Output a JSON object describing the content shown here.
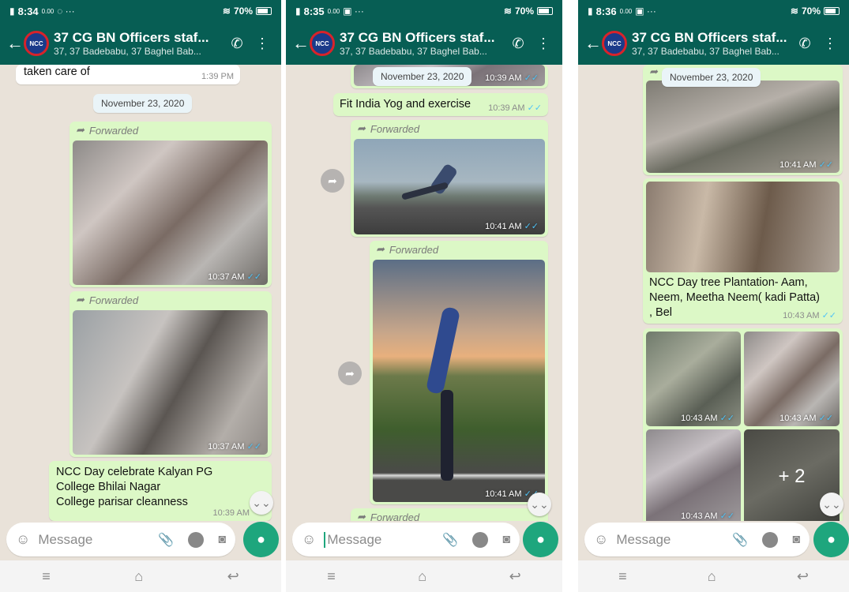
{
  "colors": {
    "header": "#075e54",
    "outgoing": "#dcf8c6",
    "mic": "#1ea67d",
    "ticks": "#4fc3f7"
  },
  "panels": [
    {
      "status": {
        "time": "8:34",
        "net": "0.00",
        "battery": "70%"
      },
      "header": {
        "title": "37 CG BN Officers staf...",
        "subtitle": "37, 37 Badebabu, 37 Baghel Bab..."
      },
      "msgs": {
        "m0_text": "taken care of",
        "m0_time": "1:39 PM",
        "date": "November 23, 2020",
        "m1_fwd": "Forwarded",
        "m1_time": "10:37 AM",
        "m2_fwd": "Forwarded",
        "m2_time": "10:37 AM",
        "m3_text": [
          "NCC Day celebrate Kalyan PG",
          "College Bhilai Nagar",
          "College parisar cleanness"
        ],
        "m3_time": "10:39 AM"
      },
      "input": {
        "placeholder": "Message"
      }
    },
    {
      "status": {
        "time": "8:35",
        "net": "0.00",
        "battery": "70%"
      },
      "header": {
        "title": "37 CG BN Officers staf...",
        "subtitle": "37, 37 Badebabu, 37 Baghel Bab..."
      },
      "msgs": {
        "date": "November 23, 2020",
        "m0_time": "10:39 AM",
        "m1_text": "Fit India Yog and exercise",
        "m1_time": "10:39 AM",
        "m2_fwd": "Forwarded",
        "m2_time": "10:41 AM",
        "m3_fwd": "Forwarded",
        "m3_time": "10:41 AM",
        "m4_fwd": "Forwarded"
      },
      "input": {
        "placeholder": "Message"
      }
    },
    {
      "status": {
        "time": "8:36",
        "net": "0.00",
        "battery": "70%"
      },
      "header": {
        "title": "37 CG BN Officers staf...",
        "subtitle": "37, 37 Badebabu, 37 Baghel Bab..."
      },
      "msgs": {
        "date": "November 23, 2020",
        "m0_time": "10:41 AM",
        "m1_text": "NCC Day tree Plantation- Aam, Neem, Meetha Neem( kadi Patta) , Bel",
        "m1_time": "10:43 AM",
        "g1_time": "10:43 AM",
        "g2_time": "10:43 AM",
        "g3_time": "10:43 AM",
        "more": "+ 2"
      },
      "input": {
        "placeholder": "Message"
      }
    }
  ]
}
